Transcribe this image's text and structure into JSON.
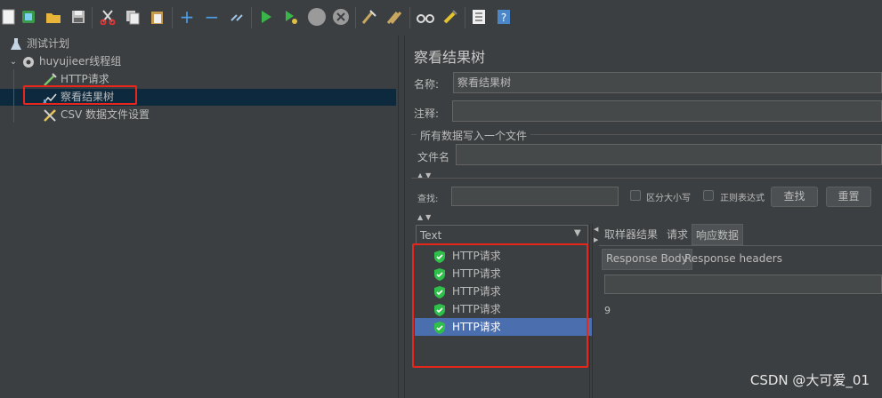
{
  "toolbar": {
    "icons": [
      "new-icon",
      "templates-icon",
      "open-icon",
      "save-icon",
      "cut-icon",
      "copy-icon",
      "paste-icon",
      "expand-icon",
      "collapse-icon",
      "toggle-icon",
      "start-icon",
      "start-no-pause-icon",
      "stop-icon",
      "shutdown-icon",
      "clear-icon",
      "clear-all-icon",
      "search-icon",
      "reset-search-icon",
      "function-helper-icon",
      "help-icon"
    ]
  },
  "tree": {
    "items": [
      {
        "label": "测试计划",
        "icon": "test-plan-icon"
      },
      {
        "label": "huyujieer线程组",
        "icon": "gear-icon"
      },
      {
        "label": "HTTP请求",
        "icon": "pipette-icon"
      },
      {
        "label": "察看结果树",
        "icon": "chart-icon"
      },
      {
        "label": "CSV 数据文件设置",
        "icon": "wrench-icon"
      }
    ]
  },
  "panel": {
    "title": "察看结果树",
    "name_label": "名称:",
    "name_value": "察看结果树",
    "comment_label": "注释:",
    "comment_value": "",
    "file_section": "所有数据写入一个文件",
    "file_label": "文件名",
    "file_value": "",
    "search_label": "查找:",
    "search_value": "",
    "case_label": "区分大小写",
    "regex_label": "正则表达式",
    "find_button": "查找",
    "reset_button": "重置"
  },
  "results": {
    "renderer": "Text",
    "items": [
      "HTTP请求",
      "HTTP请求",
      "HTTP请求",
      "HTTP请求",
      "HTTP请求"
    ],
    "selected_index": 4
  },
  "detail": {
    "tabs": [
      "取样器结果",
      "请求",
      "响应数据"
    ],
    "active_tab": "响应数据",
    "subtabs": [
      "Response Body",
      "Response headers"
    ],
    "active_subtab": "Response Body",
    "body": "9"
  },
  "watermark": "CSDN @大可爱_01",
  "colors": {
    "background": "#3c3f41",
    "selection": "#0d293e",
    "result_selection": "#4b6eaf",
    "annotation_red": "#e8261c",
    "success_green": "#2fbf4a"
  }
}
